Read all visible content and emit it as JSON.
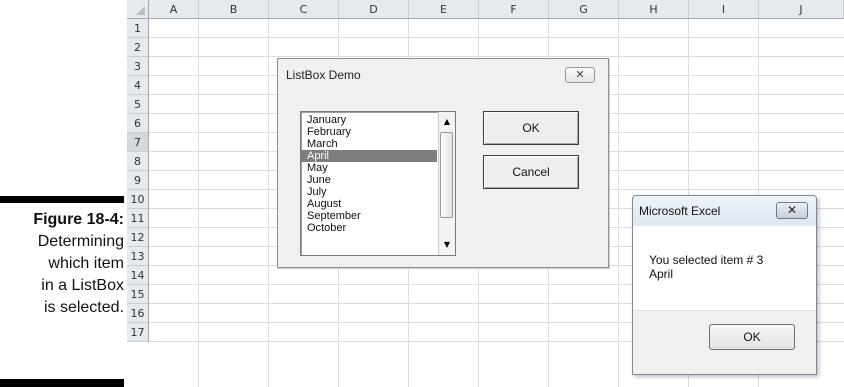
{
  "caption": {
    "figure": "Figure 18-4:",
    "lines": [
      "Determining",
      "which item",
      "in a ListBox",
      "is selected."
    ]
  },
  "sheet": {
    "columns": [
      "A",
      "B",
      "C",
      "D",
      "E",
      "F",
      "G",
      "H",
      "I",
      "J"
    ],
    "rows": [
      "1",
      "2",
      "3",
      "4",
      "5",
      "6",
      "7",
      "8",
      "9",
      "10",
      "11",
      "12",
      "13",
      "14",
      "15",
      "16",
      "17"
    ],
    "selected_row": "7"
  },
  "userform": {
    "title": "ListBox Demo",
    "close_glyph": "✕",
    "listbox": {
      "items": [
        "January",
        "February",
        "March",
        "April",
        "May",
        "June",
        "July",
        "August",
        "September",
        "October"
      ],
      "selected_index": 3,
      "up_arrow": "▲",
      "down_arrow": "▼"
    },
    "ok_label": "OK",
    "cancel_label": "Cancel"
  },
  "msgbox": {
    "title": "Microsoft Excel",
    "close_glyph": "✕",
    "line1": "You selected item # 3",
    "line2": "April",
    "ok_label": "OK"
  },
  "colors": {
    "header_bg": "#e6e9ee",
    "selection": "#7d7d7d",
    "grid": "#dadde2"
  }
}
